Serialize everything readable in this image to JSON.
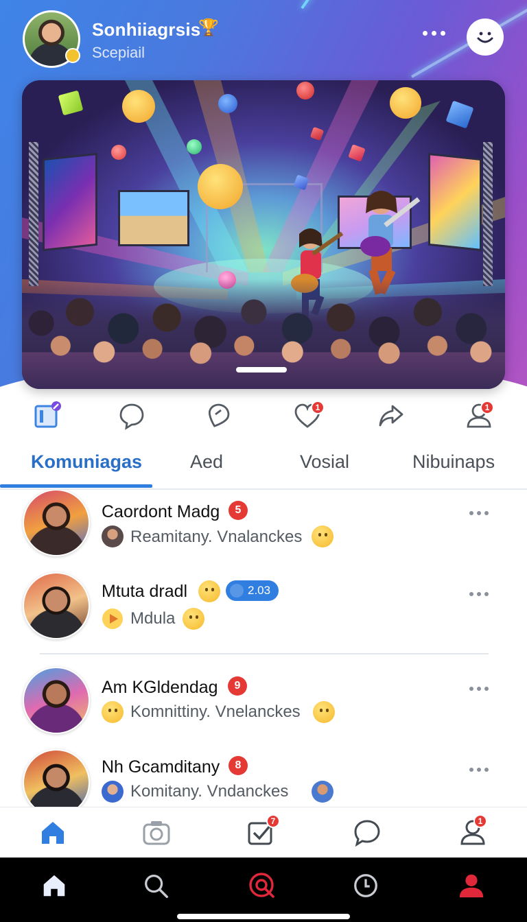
{
  "header": {
    "user_name": "Sonhiiagrsis",
    "user_subtitle": "Scepiail",
    "menu_icon": "more-horizontal-icon",
    "action_icon": "smile-icon"
  },
  "hero": {
    "image_subject": "concert-stage-with-guitarists-and-crowd",
    "accent_color": "#2f7ee0"
  },
  "actions": [
    {
      "icon": "edit-pen-icon",
      "badge": ""
    },
    {
      "icon": "chat-bubble-icon",
      "badge": ""
    },
    {
      "icon": "location-pin-icon",
      "badge": ""
    },
    {
      "icon": "heart-icon",
      "badge": "1"
    },
    {
      "icon": "share-icon",
      "badge": ""
    },
    {
      "icon": "person-icon",
      "badge": "1"
    }
  ],
  "tabs": [
    {
      "label": "Komuniagas",
      "active": true
    },
    {
      "label": "Aed",
      "active": false
    },
    {
      "label": "Vosial",
      "active": false
    },
    {
      "label": "Nibuinaps",
      "active": false
    }
  ],
  "feed": [
    {
      "name": "Caordont Madg",
      "badge": "5",
      "subtitle": "Reamitany. Vnalanckes"
    },
    {
      "name": "Mtuta dradl",
      "pill": "2.03",
      "subtitle": "Mdula"
    },
    {
      "name": "Am KGldendag",
      "badge": "9",
      "subtitle": "Komnittiny. Vnelanckes"
    },
    {
      "name": "Nh Gcamditany",
      "badge": "8",
      "subtitle": "Komitany. Vndanckes"
    }
  ],
  "app_bar": [
    {
      "icon": "home-icon",
      "badge": ""
    },
    {
      "icon": "camera-icon",
      "badge": ""
    },
    {
      "icon": "checkbox-icon",
      "badge": "7"
    },
    {
      "icon": "chat-icon",
      "badge": ""
    },
    {
      "icon": "profile-icon",
      "badge": "1"
    }
  ],
  "system_bar": [
    {
      "icon": "home-icon"
    },
    {
      "icon": "search-icon"
    },
    {
      "icon": "target-search-icon"
    },
    {
      "icon": "clock-icon"
    },
    {
      "icon": "user-icon"
    }
  ]
}
